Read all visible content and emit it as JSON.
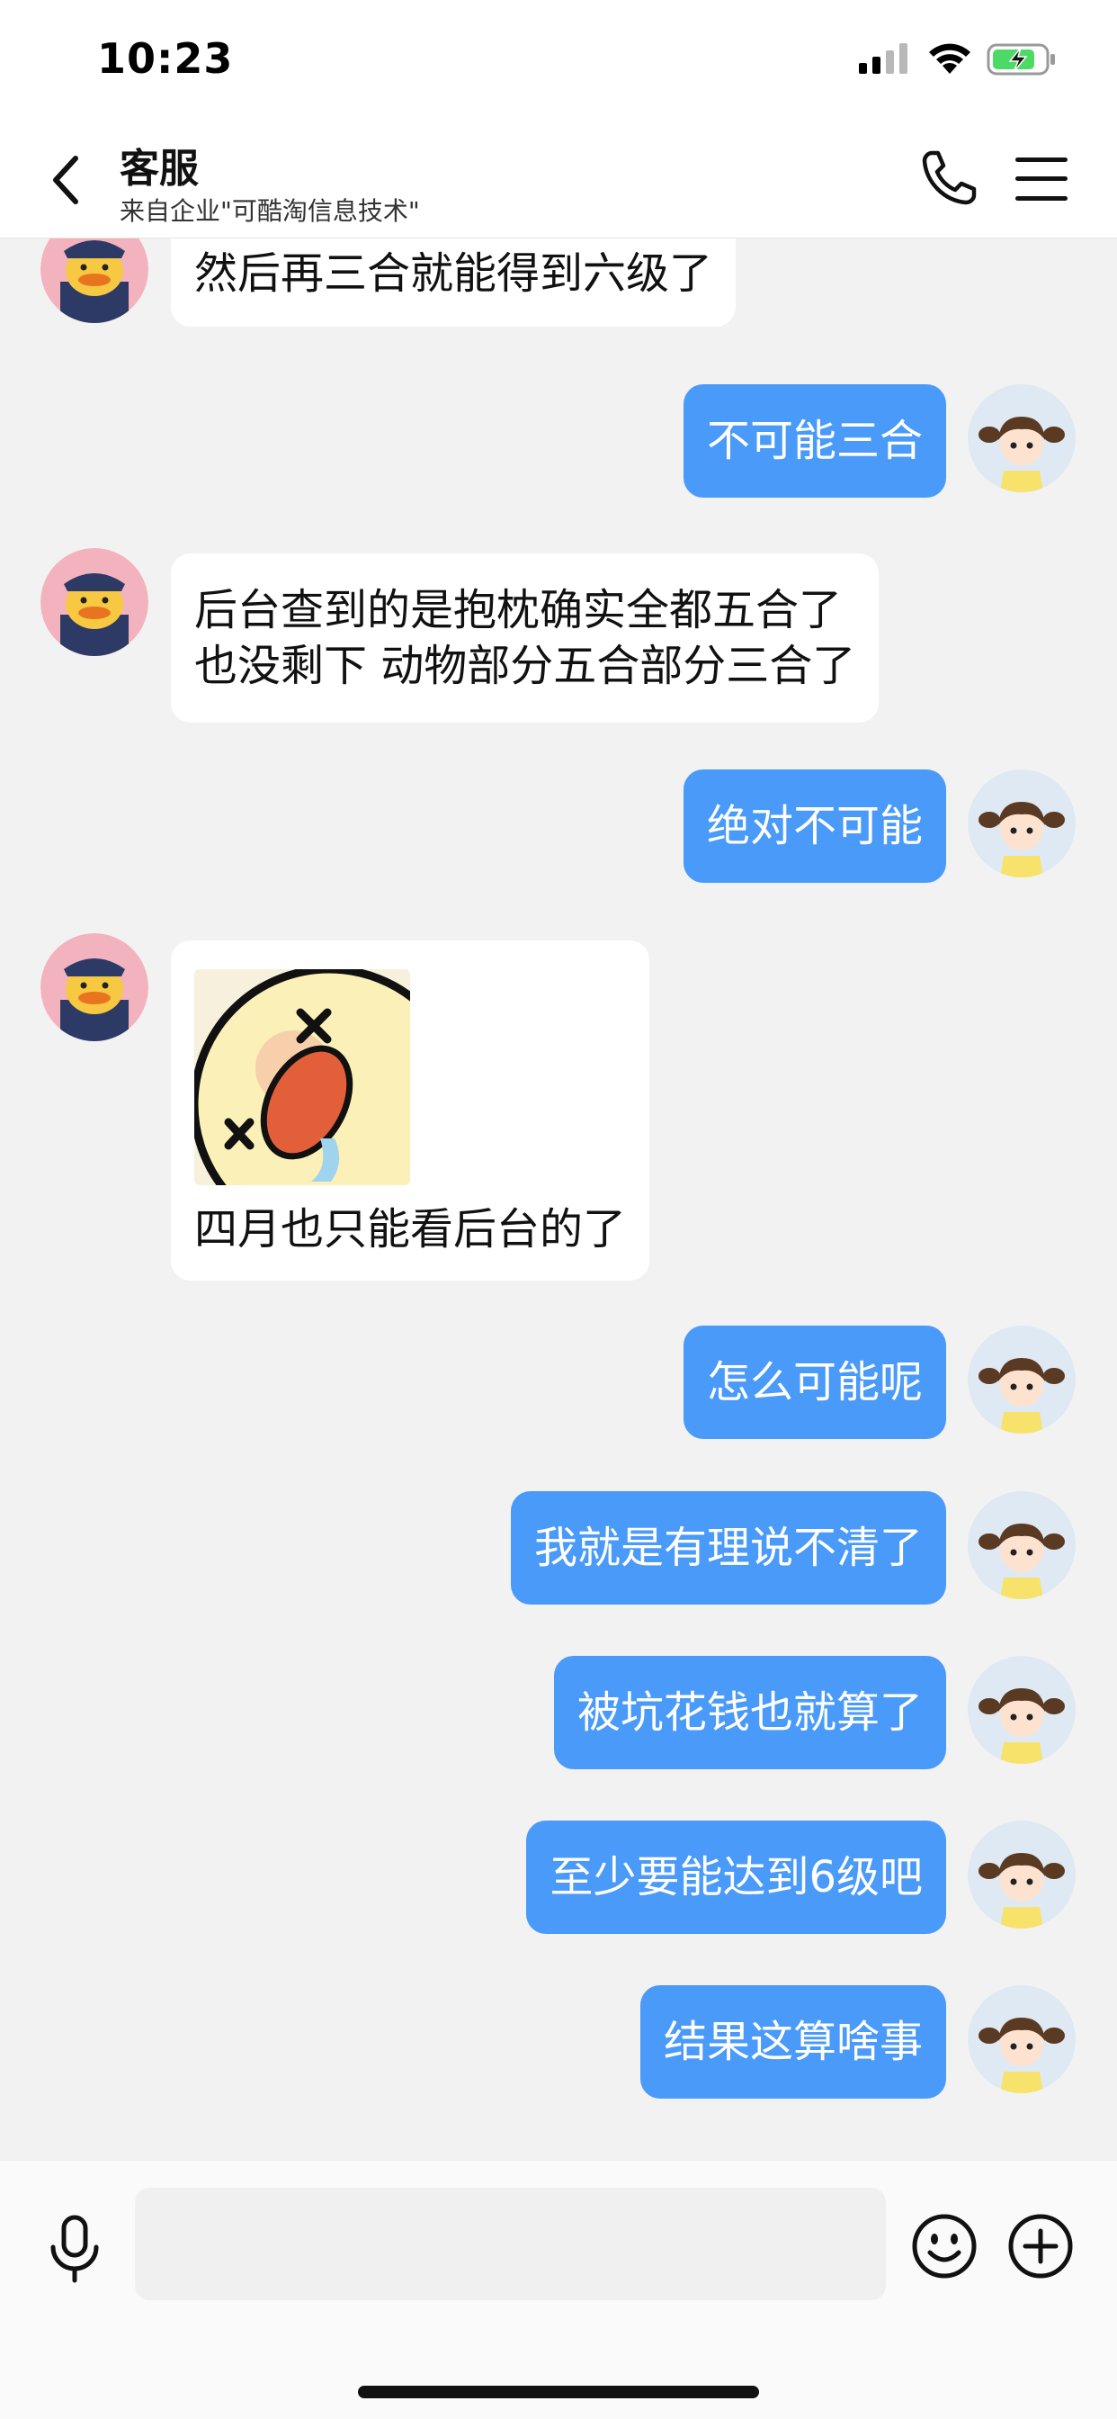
{
  "status_bar": {
    "time": "10:23"
  },
  "header": {
    "title": "客服",
    "subtitle": "来自企业\"可酷淘信息技术\""
  },
  "messages": [
    {
      "side": "in",
      "text": "然后再三合就能得到六级了"
    },
    {
      "side": "out",
      "text": "不可能三合"
    },
    {
      "side": "in",
      "lines": [
        "后台查到的是抱枕确实全都五合了",
        "也没剩下 动物部分五合部分三合了"
      ]
    },
    {
      "side": "out",
      "text": "绝对不可能"
    },
    {
      "side": "in",
      "sticker": "sad-face-sticker",
      "text": "四月也只能看后台的了"
    },
    {
      "side": "out",
      "text": "怎么可能呢"
    },
    {
      "side": "out",
      "text": "我就是有理说不清了"
    },
    {
      "side": "out",
      "text": "被坑花钱也就算了"
    },
    {
      "side": "out",
      "text": "至少要能达到6级吧"
    },
    {
      "side": "out",
      "text": "结果这算啥事"
    }
  ],
  "input": {
    "value": "",
    "placeholder": ""
  },
  "icons": {
    "back": "chevron-left-icon",
    "call": "phone-icon",
    "menu": "menu-icon",
    "voice": "microphone-icon",
    "emoji": "emoji-icon",
    "more": "plus-circle-icon"
  },
  "colors": {
    "outgoing_bubble": "#4a9afa",
    "incoming_bubble": "#ffffff",
    "background": "#f2f2f2",
    "battery_fill": "#4cd964"
  }
}
